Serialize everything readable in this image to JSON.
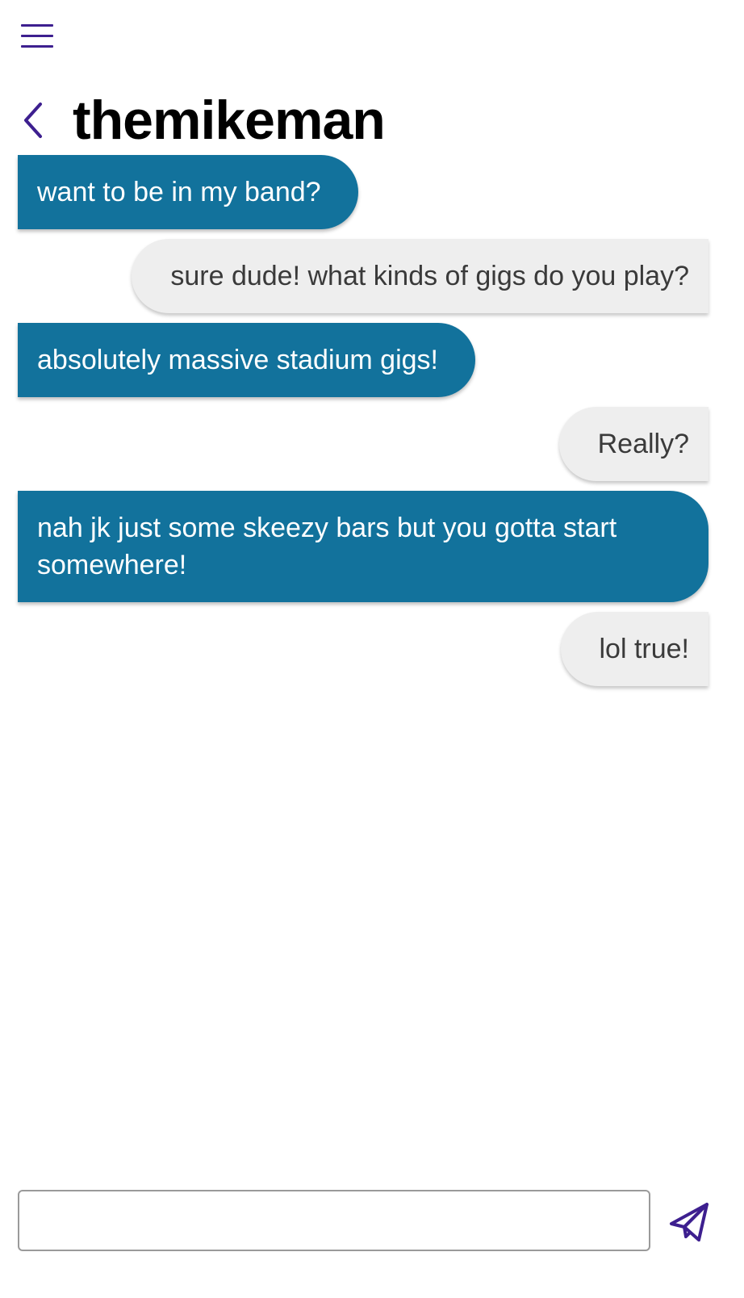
{
  "header": {
    "title": "themikeman"
  },
  "messages": [
    {
      "side": "received",
      "text": "want to be in my band?"
    },
    {
      "side": "sent",
      "text": "sure dude! what kinds of gigs do you play?"
    },
    {
      "side": "received",
      "text": "absolutely massive stadium gigs!"
    },
    {
      "side": "sent",
      "text": "Really?"
    },
    {
      "side": "received",
      "text": "nah jk just some skeezy bars but you gotta start somewhere!"
    },
    {
      "side": "sent",
      "text": "lol true!"
    }
  ],
  "composer": {
    "value": "",
    "placeholder": ""
  },
  "icons": {
    "menu": "hamburger-menu-icon",
    "back": "chevron-left-icon",
    "send": "paper-plane-send-icon"
  },
  "colors": {
    "accent": "#3d1f8f",
    "received_bubble": "#12729c",
    "sent_bubble": "#eeeeee"
  }
}
